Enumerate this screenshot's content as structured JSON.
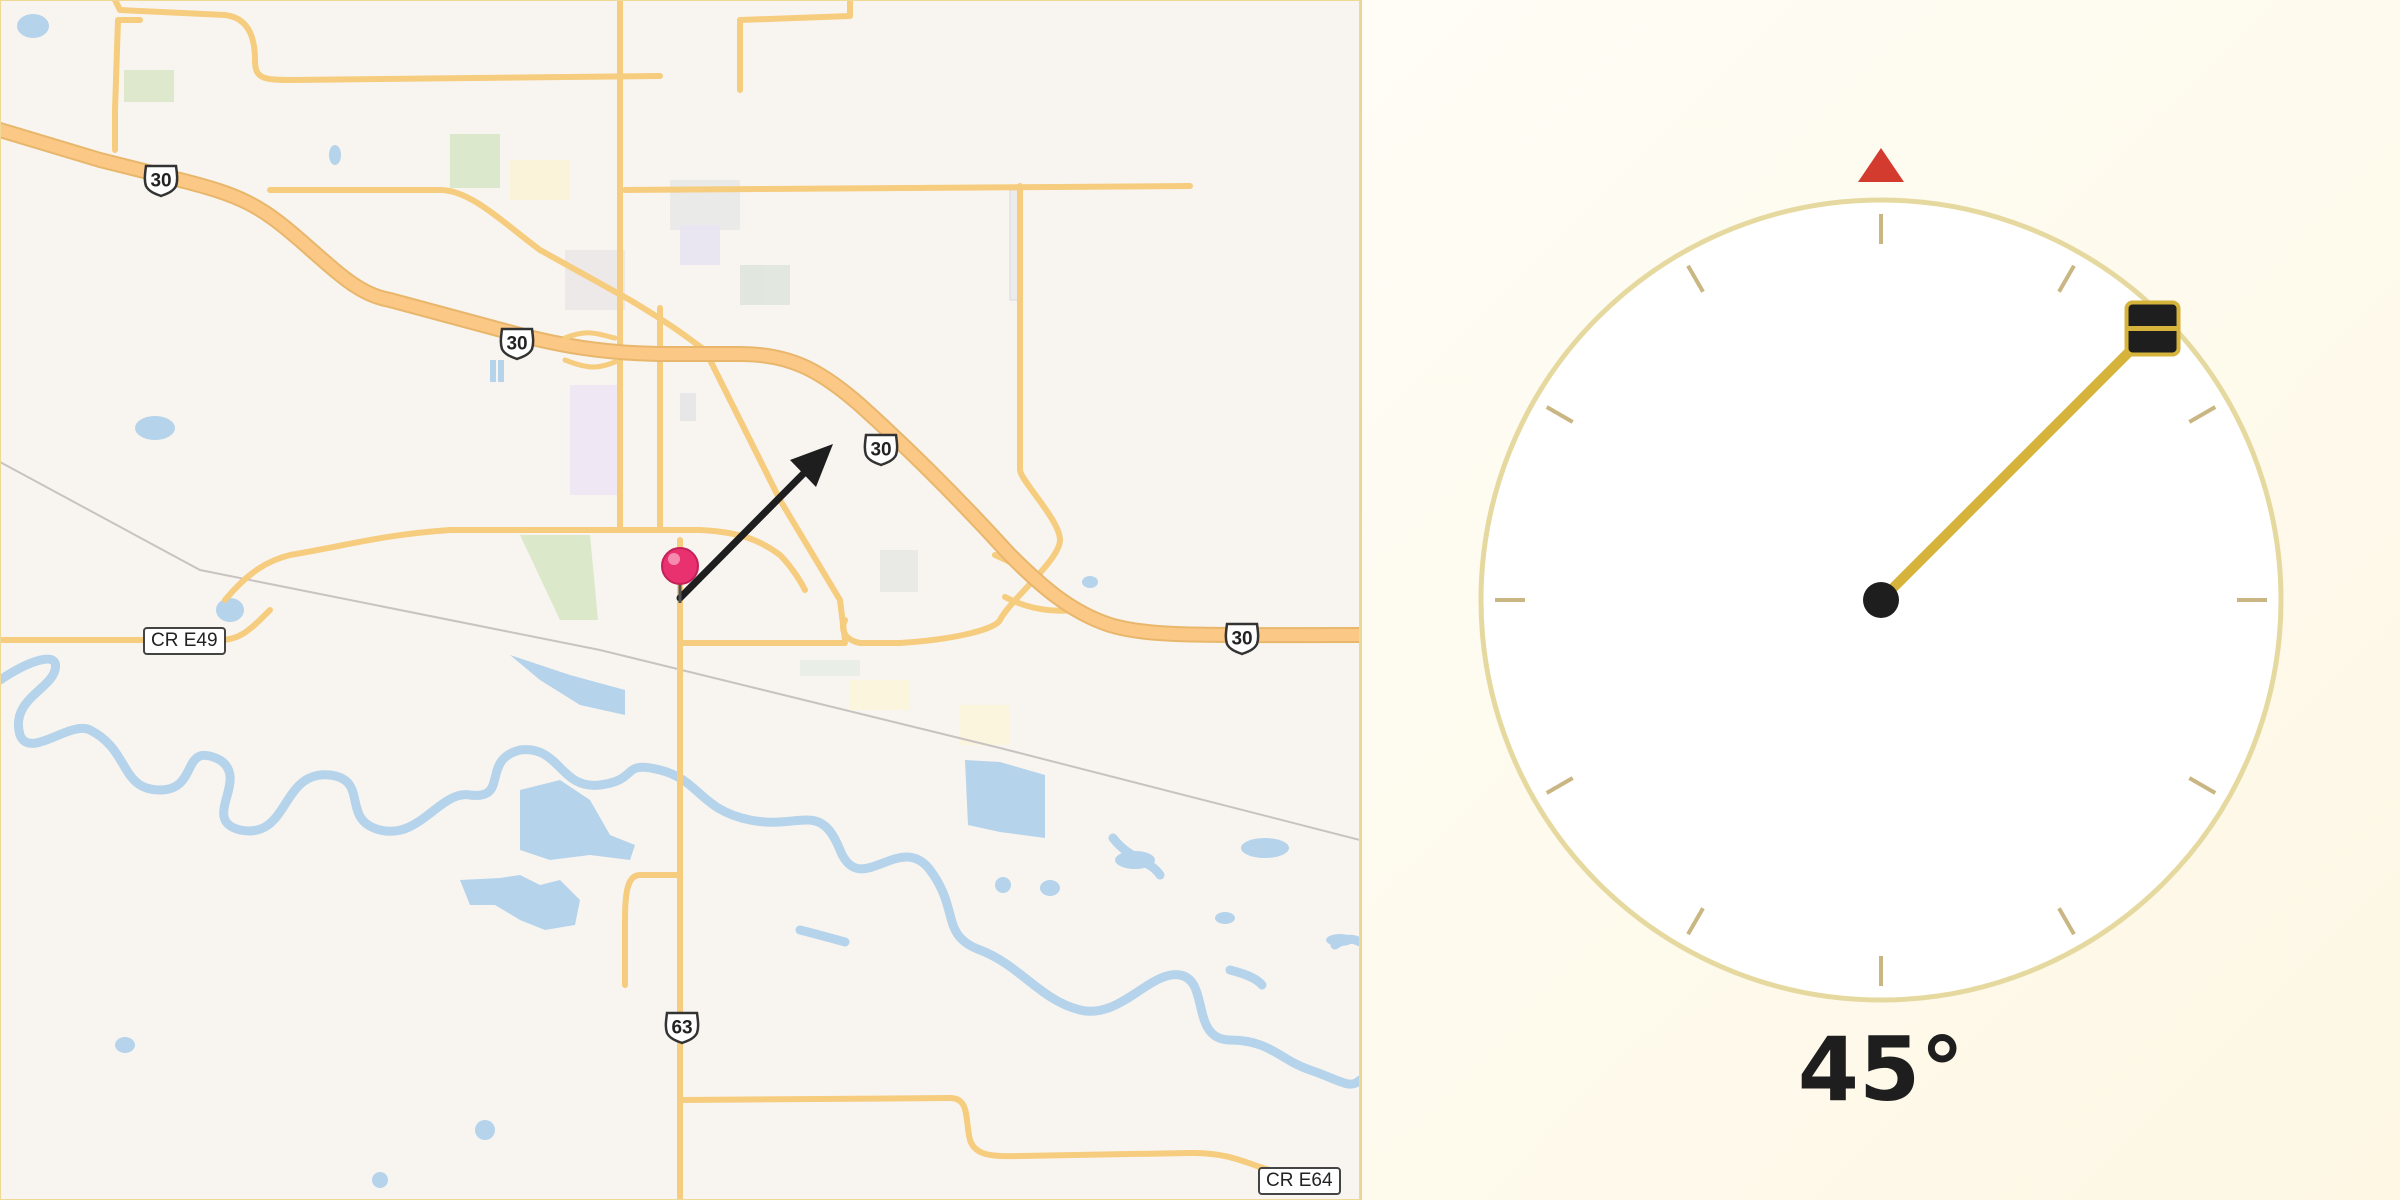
{
  "map": {
    "route_shields": [
      {
        "id": "us30-a",
        "label": "30"
      },
      {
        "id": "us30-b",
        "label": "30"
      },
      {
        "id": "us30-c",
        "label": "30"
      },
      {
        "id": "us30-d",
        "label": "30"
      },
      {
        "id": "us63",
        "label": "63"
      }
    ],
    "county_labels": [
      {
        "id": "cr-e49",
        "label": "CR E49"
      },
      {
        "id": "cr-e64",
        "label": "CR E64"
      }
    ],
    "location_pin_color": "#e8316e",
    "direction_arrow_color": "#1e1e1e"
  },
  "compass": {
    "heading_degrees": 45,
    "heading_text": "45°",
    "north_marker_color": "#d23b2e",
    "needle_color": "#d6b43c",
    "dial_ring_color": "#e6d9a0"
  }
}
